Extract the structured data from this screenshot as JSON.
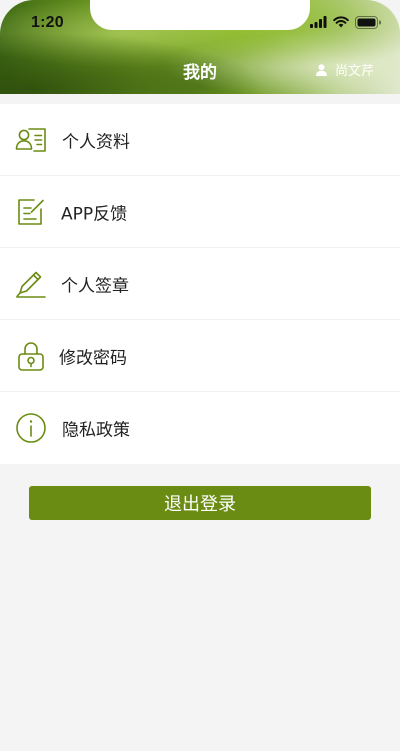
{
  "status_bar": {
    "time": "1:20"
  },
  "header": {
    "title": "我的",
    "user_name": "尚文芹"
  },
  "menu": {
    "items": [
      {
        "label": "个人资料",
        "icon": "profile-card-icon"
      },
      {
        "label": "APP反馈",
        "icon": "feedback-edit-icon"
      },
      {
        "label": "个人签章",
        "icon": "signature-pen-icon"
      },
      {
        "label": "修改密码",
        "icon": "lock-icon"
      },
      {
        "label": "隐私政策",
        "icon": "info-icon"
      }
    ]
  },
  "logout_label": "退出登录",
  "colors": {
    "accent": "#6b8c13",
    "icon_stroke": "#6b8c13"
  }
}
